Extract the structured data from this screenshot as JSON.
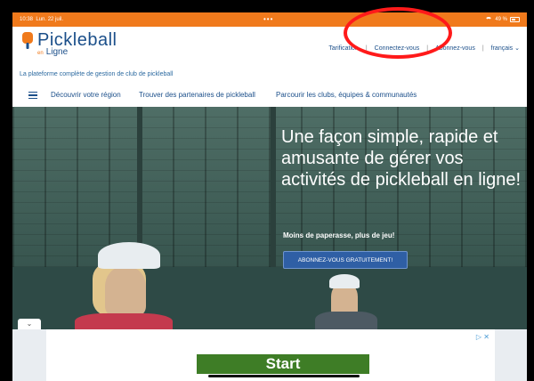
{
  "status": {
    "time": "10:38",
    "date": "Lun. 22 juil.",
    "battery": "49 %"
  },
  "header": {
    "logo_main": "Pickleball",
    "logo_prefix": "en",
    "logo_sub": "Ligne",
    "tagline": "La plateforme complète de gestion de club de pickleball",
    "nav": {
      "pricing": "Tarification",
      "login": "Connectez-vous",
      "subscribe": "Abonnez-vous",
      "language": "français"
    }
  },
  "menu": {
    "items": [
      "Découvrir votre région",
      "Trouver des partenaires de pickleball",
      "Parcourir les clubs, équipes & communautés"
    ]
  },
  "hero": {
    "title": "Une façon simple, rapide et amusante de gérer vos activités de pickleball en ligne!",
    "subtitle": "Moins de paperasse, plus de jeu!",
    "cta": "ABONNEZ-VOUS GRATUITEMENT!"
  },
  "ad": {
    "button": "Start",
    "close": "▷ ✕"
  },
  "colors": {
    "brand": "#1b4f8a",
    "accent": "#f07a1c",
    "cta": "#2f5fa5",
    "annotation": "#ff1a1a"
  }
}
